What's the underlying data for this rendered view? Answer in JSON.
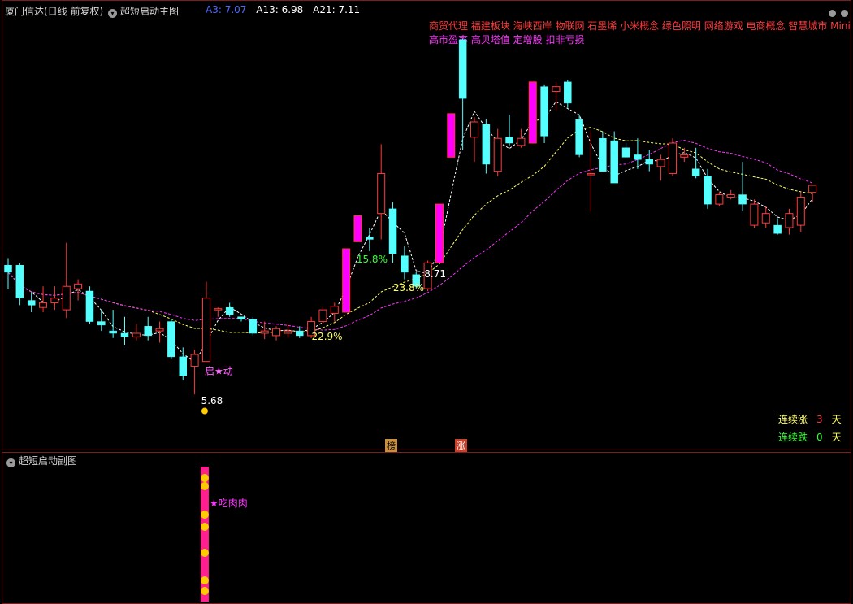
{
  "header": {
    "title": "厦门信达(日线 前复权)",
    "main_indicator": "超短启动主图",
    "ma_values": [
      {
        "label": "A3: 7.07",
        "color": "#4d6bff"
      },
      {
        "label": "A13: 6.98",
        "color": "#ffffff"
      },
      {
        "label": "A21: 7.11",
        "color": "#ffffff"
      }
    ]
  },
  "concepts_line1": "商贸代理 福建板块 海峡西岸 物联网 石墨烯 小米概念 绿色照明 网络游戏 电商概念 智慧城市 MiniLE",
  "concepts_line2": "高市盈率 高贝塔值 定增股 扣非亏损",
  "sub_panel": {
    "title": "超短启动副图",
    "annotation": "吃肉肉"
  },
  "stats": {
    "up_label": "连续涨",
    "up_value": "3",
    "up_unit": "天",
    "down_label": "连续跌",
    "down_value": "0",
    "down_unit": "天"
  },
  "badges": {
    "bang": "榜",
    "zhang": "涨"
  },
  "colors": {
    "up": "#ff3b3b",
    "down": "#54ffff",
    "signal": "#ff00ff",
    "ma3": "#ffffff",
    "ma13": "#ffff66",
    "ma21": "#ff33ff"
  },
  "chart_data": {
    "type": "candlestick",
    "description_free": true,
    "n": 70,
    "ylim": [
      5.3,
      8.9
    ],
    "candles": [
      {
        "o": 6.78,
        "h": 6.84,
        "l": 6.58,
        "c": 6.72
      },
      {
        "o": 6.78,
        "h": 6.8,
        "l": 6.44,
        "c": 6.5
      },
      {
        "o": 6.48,
        "h": 6.55,
        "l": 6.38,
        "c": 6.44
      },
      {
        "o": 6.42,
        "h": 6.6,
        "l": 6.38,
        "c": 6.46
      },
      {
        "o": 6.46,
        "h": 6.6,
        "l": 6.4,
        "c": 6.5
      },
      {
        "o": 6.4,
        "h": 6.97,
        "l": 6.33,
        "c": 6.6
      },
      {
        "o": 6.58,
        "h": 6.66,
        "l": 6.48,
        "c": 6.62
      },
      {
        "o": 6.56,
        "h": 6.6,
        "l": 6.28,
        "c": 6.3
      },
      {
        "o": 6.3,
        "h": 6.4,
        "l": 6.22,
        "c": 6.27
      },
      {
        "o": 6.22,
        "h": 6.4,
        "l": 6.16,
        "c": 6.2
      },
      {
        "o": 6.2,
        "h": 6.34,
        "l": 6.1,
        "c": 6.17
      },
      {
        "o": 6.17,
        "h": 6.28,
        "l": 6.14,
        "c": 6.2
      },
      {
        "o": 6.26,
        "h": 6.34,
        "l": 6.14,
        "c": 6.18
      },
      {
        "o": 6.22,
        "h": 6.3,
        "l": 6.12,
        "c": 6.24
      },
      {
        "o": 6.3,
        "h": 6.32,
        "l": 5.98,
        "c": 6.0
      },
      {
        "o": 6.0,
        "h": 6.08,
        "l": 5.8,
        "c": 5.84
      },
      {
        "o": 5.92,
        "h": 6.06,
        "l": 5.68,
        "c": 6.02
      },
      {
        "o": 5.96,
        "h": 6.64,
        "l": 5.96,
        "c": 6.5
      },
      {
        "o": 6.4,
        "h": 6.42,
        "l": 6.34,
        "c": 6.41
      },
      {
        "o": 6.42,
        "h": 6.46,
        "l": 6.34,
        "c": 6.36
      },
      {
        "o": 6.34,
        "h": 6.34,
        "l": 6.3,
        "c": 6.32
      },
      {
        "o": 6.32,
        "h": 6.34,
        "l": 6.18,
        "c": 6.2
      },
      {
        "o": 6.2,
        "h": 6.3,
        "l": 6.15,
        "c": 6.22
      },
      {
        "o": 6.18,
        "h": 6.26,
        "l": 6.14,
        "c": 6.24
      },
      {
        "o": 6.2,
        "h": 6.28,
        "l": 6.16,
        "c": 6.22
      },
      {
        "o": 6.22,
        "h": 6.26,
        "l": 6.16,
        "c": 6.18
      },
      {
        "o": 6.18,
        "h": 6.34,
        "l": 6.16,
        "c": 6.3
      },
      {
        "o": 6.3,
        "h": 6.42,
        "l": 6.28,
        "c": 6.4
      },
      {
        "o": 6.37,
        "h": 6.46,
        "l": 6.3,
        "c": 6.43
      },
      {
        "o": 6.38,
        "h": 6.92,
        "l": 6.38,
        "c": 6.92,
        "limit": true
      },
      {
        "o": 6.98,
        "h": 7.2,
        "l": 6.98,
        "c": 7.2,
        "limit": true
      },
      {
        "o": 7.02,
        "h": 7.1,
        "l": 6.9,
        "c": 7.0
      },
      {
        "o": 7.22,
        "h": 7.81,
        "l": 7.0,
        "c": 7.56
      },
      {
        "o": 7.26,
        "h": 7.32,
        "l": 6.8,
        "c": 6.88
      },
      {
        "o": 6.86,
        "h": 6.94,
        "l": 6.66,
        "c": 6.72
      },
      {
        "o": 6.7,
        "h": 6.72,
        "l": 6.58,
        "c": 6.6
      },
      {
        "o": 6.58,
        "h": 6.82,
        "l": 6.56,
        "c": 6.8
      },
      {
        "o": 6.8,
        "h": 7.3,
        "l": 6.8,
        "c": 7.3,
        "limit": true
      },
      {
        "o": 7.7,
        "h": 7.94,
        "l": 7.7,
        "c": 8.07,
        "limit": true
      },
      {
        "o": 8.7,
        "h": 8.71,
        "l": 7.76,
        "c": 8.2
      },
      {
        "o": 7.87,
        "h": 8.04,
        "l": 7.66,
        "c": 8.0
      },
      {
        "o": 7.98,
        "h": 8.02,
        "l": 7.56,
        "c": 7.64
      },
      {
        "o": 7.58,
        "h": 7.94,
        "l": 7.54,
        "c": 7.86
      },
      {
        "o": 7.87,
        "h": 8.06,
        "l": 7.8,
        "c": 7.82
      },
      {
        "o": 7.8,
        "h": 7.94,
        "l": 7.78,
        "c": 7.86
      },
      {
        "o": 7.82,
        "h": 8.32,
        "l": 7.82,
        "c": 8.34,
        "limit": true
      },
      {
        "o": 8.3,
        "h": 8.32,
        "l": 7.82,
        "c": 7.88
      },
      {
        "o": 8.26,
        "h": 8.34,
        "l": 8.1,
        "c": 8.3
      },
      {
        "o": 8.34,
        "h": 8.36,
        "l": 8.12,
        "c": 8.16
      },
      {
        "o": 8.02,
        "h": 8.06,
        "l": 7.7,
        "c": 7.72
      },
      {
        "o": 7.56,
        "h": 7.92,
        "l": 7.24,
        "c": 7.56
      },
      {
        "o": 7.86,
        "h": 7.92,
        "l": 7.6,
        "c": 7.58
      },
      {
        "o": 7.84,
        "h": 7.92,
        "l": 7.7,
        "c": 7.48
      },
      {
        "o": 7.78,
        "h": 7.82,
        "l": 7.72,
        "c": 7.7
      },
      {
        "o": 7.72,
        "h": 7.86,
        "l": 7.6,
        "c": 7.68
      },
      {
        "o": 7.68,
        "h": 7.76,
        "l": 7.58,
        "c": 7.64
      },
      {
        "o": 7.62,
        "h": 7.72,
        "l": 7.5,
        "c": 7.68
      },
      {
        "o": 7.56,
        "h": 7.86,
        "l": 7.54,
        "c": 7.82
      },
      {
        "o": 7.7,
        "h": 7.78,
        "l": 7.66,
        "c": 7.72
      },
      {
        "o": 7.6,
        "h": 7.78,
        "l": 7.52,
        "c": 7.54
      },
      {
        "o": 7.54,
        "h": 7.6,
        "l": 7.26,
        "c": 7.3
      },
      {
        "o": 7.3,
        "h": 7.4,
        "l": 7.28,
        "c": 7.38
      },
      {
        "o": 7.36,
        "h": 7.42,
        "l": 7.34,
        "c": 7.38
      },
      {
        "o": 7.38,
        "h": 7.66,
        "l": 7.24,
        "c": 7.3
      },
      {
        "o": 7.12,
        "h": 7.34,
        "l": 7.1,
        "c": 7.3
      },
      {
        "o": 7.14,
        "h": 7.28,
        "l": 7.1,
        "c": 7.22
      },
      {
        "o": 7.12,
        "h": 7.18,
        "l": 7.04,
        "c": 7.05
      },
      {
        "o": 7.1,
        "h": 7.26,
        "l": 7.04,
        "c": 7.22
      },
      {
        "o": 7.12,
        "h": 7.4,
        "l": 7.06,
        "c": 7.36
      },
      {
        "o": 7.4,
        "h": 7.44,
        "l": 7.32,
        "c": 7.46
      }
    ],
    "annotations": [
      {
        "text": "22.9%",
        "color": "#ffff66",
        "at": 27
      },
      {
        "text": "23.8%",
        "color": "#ffff66",
        "at": 34
      },
      {
        "text": "15.8%",
        "color": "#33ff33",
        "at": 31
      },
      {
        "text": "8.71",
        "color": "#ffffff",
        "at": 35
      },
      {
        "text": "5.68",
        "color": "#ffffff",
        "at": 16
      },
      {
        "text": "启★动",
        "color": "#ff66ff",
        "at": 17
      }
    ]
  }
}
